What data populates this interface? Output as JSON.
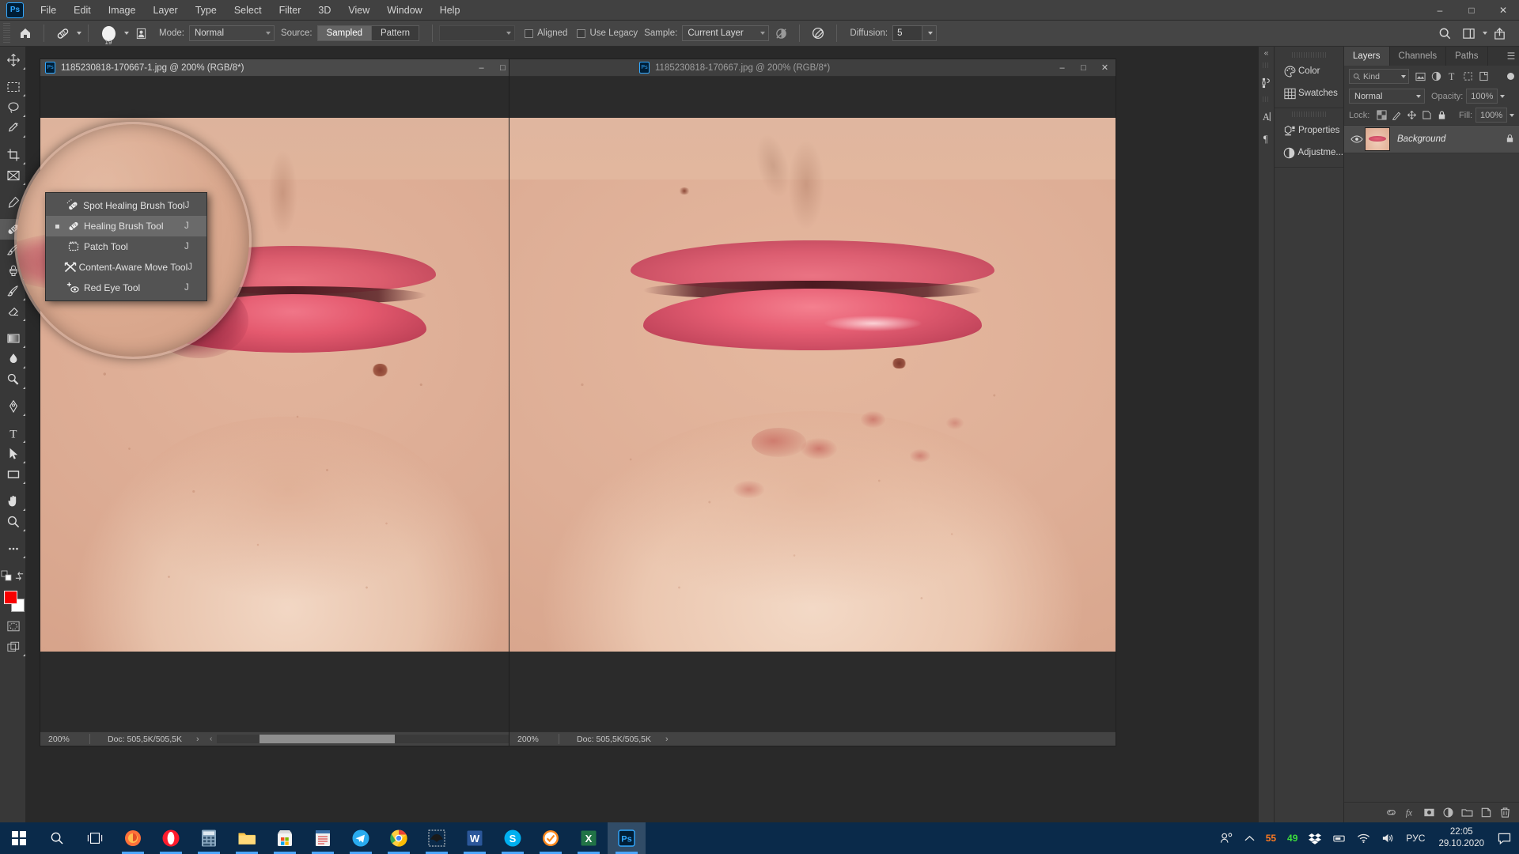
{
  "app": {
    "name": "Adobe Photoshop",
    "logo_text": "Ps"
  },
  "menubar": {
    "items": [
      "File",
      "Edit",
      "Image",
      "Layer",
      "Type",
      "Select",
      "Filter",
      "3D",
      "View",
      "Window",
      "Help"
    ],
    "window_controls": {
      "minimize": "–",
      "maximize": "□",
      "close": "✕"
    }
  },
  "options_bar": {
    "home_icon": "home-icon",
    "tool_icon": "healing-brush-icon",
    "brush_size": "19",
    "mode_label": "Mode:",
    "mode_value": "Normal",
    "source_label": "Source:",
    "source_options": [
      "Sampled",
      "Pattern"
    ],
    "source_active": "Sampled",
    "aligned_label": "Aligned",
    "aligned_checked": false,
    "use_legacy_label": "Use Legacy",
    "use_legacy_checked": false,
    "sample_label": "Sample:",
    "sample_value": "Current Layer",
    "ignore_adjustment_icon": "ignore-adjustment-layers-icon",
    "pressure_icon": "pressure-size-icon",
    "diffusion_label": "Diffusion:",
    "diffusion_value": "5",
    "search_icon": "search-icon",
    "workspace_icon": "workspace-icon",
    "share_icon": "share-icon"
  },
  "toolbar": {
    "tools": [
      {
        "name": "move-tool",
        "glyph": "✥",
        "active": false
      },
      {
        "name": "rectangular-marquee-tool",
        "glyph": "⬚",
        "active": false
      },
      {
        "name": "lasso-tool",
        "glyph": "○",
        "active": false
      },
      {
        "name": "object-selection-tool",
        "glyph": "✨",
        "active": false
      },
      {
        "name": "crop-tool",
        "glyph": "⌧",
        "active": false
      },
      {
        "name": "frame-tool",
        "glyph": "☒",
        "active": false
      },
      {
        "name": "eyedropper-tool",
        "glyph": "✒",
        "active": false
      },
      {
        "name": "healing-brush-tool",
        "glyph": "✐",
        "active": true
      },
      {
        "name": "brush-tool",
        "glyph": "✎",
        "active": false
      },
      {
        "name": "clone-stamp-tool",
        "glyph": "⚑",
        "active": false
      },
      {
        "name": "history-brush-tool",
        "glyph": "✒",
        "active": false
      },
      {
        "name": "eraser-tool",
        "glyph": "▱",
        "active": false
      },
      {
        "name": "gradient-tool",
        "glyph": "◧",
        "active": false
      },
      {
        "name": "blur-tool",
        "glyph": "●",
        "active": false
      },
      {
        "name": "dodge-tool",
        "glyph": "⚲",
        "active": false
      },
      {
        "name": "pen-tool",
        "glyph": "✒",
        "active": false
      },
      {
        "name": "horizontal-type-tool",
        "glyph": "T",
        "active": false
      },
      {
        "name": "path-selection-tool",
        "glyph": "➤",
        "active": false
      },
      {
        "name": "rectangle-tool",
        "glyph": "▭",
        "active": false
      },
      {
        "name": "hand-tool",
        "glyph": "✋",
        "active": false
      },
      {
        "name": "zoom-tool",
        "glyph": "⚲",
        "active": false
      },
      {
        "name": "edit-toolbar-tool",
        "glyph": "⋯",
        "active": false
      }
    ],
    "default-colors-icon": "default-colors-icon",
    "swap-colors-icon": "swap-colors-icon",
    "foreground_color": "#f80000",
    "background_color": "#ffffff",
    "quick-mask-icon": "quick-mask-icon",
    "screen-mode-icon": "screen-mode-icon"
  },
  "flyout_menu": {
    "items": [
      {
        "label": "Spot Healing Brush Tool",
        "shortcut": "J",
        "icon": "spot-healing-brush-icon",
        "selected": false,
        "bullet": false
      },
      {
        "label": "Healing Brush Tool",
        "shortcut": "J",
        "icon": "healing-brush-icon",
        "selected": true,
        "bullet": true
      },
      {
        "label": "Patch Tool",
        "shortcut": "J",
        "icon": "patch-tool-icon",
        "selected": false,
        "bullet": false
      },
      {
        "label": "Content-Aware Move Tool",
        "shortcut": "J",
        "icon": "content-aware-move-icon",
        "selected": false,
        "bullet": false
      },
      {
        "label": "Red Eye Tool",
        "shortcut": "J",
        "icon": "red-eye-tool-icon",
        "selected": false,
        "bullet": false
      }
    ]
  },
  "documents": [
    {
      "title": "1185230818-170667-1.jpg @ 200% (RGB/8*)",
      "active": true,
      "zoom": "200%",
      "doc_size": "Doc: 505,5K/505,5K",
      "window_controls": {
        "minimize": "–",
        "maximize": "□",
        "close": "✕"
      }
    },
    {
      "title": "1185230818-170667.jpg @ 200% (RGB/8*)",
      "active": false,
      "zoom": "200%",
      "doc_size": "Doc: 505,5K/505,5K",
      "window_controls": {
        "minimize": "–",
        "maximize": "□",
        "close": "✕"
      }
    }
  ],
  "icon_dock": {
    "groups": [
      [
        {
          "label": "Color",
          "icon": "color-palette-icon"
        },
        {
          "label": "Swatches",
          "icon": "swatches-grid-icon"
        }
      ],
      [
        {
          "label": "Properties",
          "icon": "properties-icon"
        },
        {
          "label": "Adjustme...",
          "icon": "adjustments-icon"
        }
      ]
    ],
    "collapse_icon": "double-chevron-left-icon",
    "rail_buttons": [
      "history-icon",
      "character-icon",
      "paragraph-icon"
    ]
  },
  "layers_panel": {
    "tabs": [
      {
        "label": "Layers",
        "active": true
      },
      {
        "label": "Channels",
        "active": false
      },
      {
        "label": "Paths",
        "active": false
      }
    ],
    "menu_icon": "panel-menu-icon",
    "filter_placeholder": "Kind",
    "filter_icons": [
      "pixel-filter-icon",
      "adjustment-filter-icon",
      "type-filter-icon",
      "shape-filter-icon",
      "smart-object-filter-icon"
    ],
    "blend_mode": "Normal",
    "opacity_label": "Opacity:",
    "opacity_value": "100%",
    "lock_label": "Lock:",
    "lock_icons": [
      "lock-transparent-pixels-icon",
      "lock-image-pixels-icon",
      "lock-position-icon",
      "lock-artboard-icon",
      "lock-all-icon"
    ],
    "fill_label": "Fill:",
    "fill_value": "100%",
    "layers": [
      {
        "name": "Background",
        "visible": true,
        "locked": true,
        "thumbnail": "face-thumbnail"
      }
    ],
    "bottom_buttons": [
      {
        "name": "link-layers-button",
        "glyph": "⚭"
      },
      {
        "name": "layer-style-button",
        "glyph": "fx"
      },
      {
        "name": "layer-mask-button",
        "glyph": "▣"
      },
      {
        "name": "adjustment-layer-button",
        "glyph": "◑"
      },
      {
        "name": "new-group-button",
        "glyph": "▱"
      },
      {
        "name": "new-layer-button",
        "glyph": "⊞"
      },
      {
        "name": "delete-layer-button",
        "glyph": "⌧"
      }
    ]
  },
  "taskbar": {
    "start_icon": "windows-start-icon",
    "search_icon": "search-icon",
    "taskview_icon": "task-view-icon",
    "apps": [
      {
        "name": "firefox",
        "label": "Firefox",
        "color": "#ff7139",
        "glyph": "●"
      },
      {
        "name": "opera",
        "label": "Opera",
        "color": "#ff1b2d",
        "glyph": "O"
      },
      {
        "name": "calculator",
        "label": "Calculator",
        "color": "#5a8fb5",
        "glyph": "⌗"
      },
      {
        "name": "file-explorer",
        "label": "File Explorer",
        "color": "#ffcf4a",
        "glyph": "▰"
      },
      {
        "name": "microsoft-store",
        "label": "Microsoft Store",
        "color": "#f2f2f2",
        "glyph": "❐"
      },
      {
        "name": "notepad",
        "label": "Notepad",
        "color": "#e8e8e8",
        "glyph": "▤"
      },
      {
        "name": "telegram",
        "label": "Telegram",
        "color": "#2aabee",
        "glyph": "➤"
      },
      {
        "name": "chrome",
        "label": "Google Chrome",
        "color": "#4285f4",
        "glyph": "●"
      },
      {
        "name": "batman-app",
        "label": "App",
        "color": "#e9e9e9",
        "glyph": "◆"
      },
      {
        "name": "word",
        "label": "Word",
        "color": "#2b579a",
        "glyph": "W"
      },
      {
        "name": "skype",
        "label": "Skype",
        "color": "#00aff0",
        "glyph": "S"
      },
      {
        "name": "antivirus",
        "label": "Antivirus",
        "color": "#ff8a1e",
        "glyph": "✔"
      },
      {
        "name": "excel",
        "label": "Excel",
        "color": "#217346",
        "glyph": "X"
      },
      {
        "name": "photoshop",
        "label": "Adobe Photoshop",
        "color": "#31a8ff",
        "glyph": "Ps"
      }
    ],
    "tray": {
      "people_icon": "people-icon",
      "show_hidden_icon": "chevron-up-icon",
      "badge_orange": "55",
      "badge_green": "49",
      "dropbox_icon": "dropbox-icon",
      "device_icon": "device-icon",
      "wifi_icon": "wifi-icon",
      "volume_icon": "volume-icon",
      "language": "РУС",
      "time": "22:05",
      "date": "29.10.2020",
      "action_center_icon": "action-center-icon"
    }
  }
}
